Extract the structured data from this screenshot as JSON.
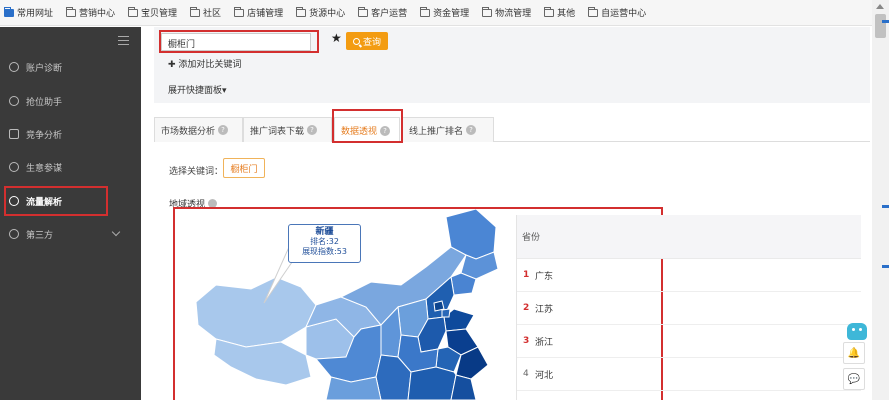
{
  "bookmarks": [
    {
      "label": "常用网址",
      "icon": "app-icon"
    },
    {
      "label": "营销中心",
      "icon": "folder-icon"
    },
    {
      "label": "宝贝管理",
      "icon": "folder-icon"
    },
    {
      "label": "社区",
      "icon": "folder-icon"
    },
    {
      "label": "店铺管理",
      "icon": "folder-icon"
    },
    {
      "label": "货源中心",
      "icon": "folder-icon"
    },
    {
      "label": "客户运营",
      "icon": "folder-icon"
    },
    {
      "label": "资金管理",
      "icon": "folder-icon"
    },
    {
      "label": "物流管理",
      "icon": "folder-icon"
    },
    {
      "label": "其他",
      "icon": "folder-icon"
    },
    {
      "label": "自运营中心",
      "icon": "folder-icon"
    }
  ],
  "sidebar": {
    "items": [
      {
        "label": "账户诊断",
        "icon": "diagnose-icon"
      },
      {
        "label": "抢位助手",
        "icon": "target-icon"
      },
      {
        "label": "竞争分析",
        "icon": "chart-icon"
      },
      {
        "label": "生意参谋",
        "icon": "compass-icon"
      },
      {
        "label": "流量解析",
        "icon": "flow-icon",
        "active": true
      },
      {
        "label": "第三方",
        "icon": "circle-icon",
        "has_submenu": true
      }
    ]
  },
  "search": {
    "keyword_value": "橱柜门",
    "query_label": "查询",
    "add_compare_label": "添加对比关键词",
    "expand_panel_label": "展开快捷面板"
  },
  "tabs": [
    {
      "label": "市场数据分析"
    },
    {
      "label": "推广词表下载"
    },
    {
      "label": "数据透视",
      "active": true
    },
    {
      "label": "线上推广排名"
    }
  ],
  "content": {
    "select_keyword_label": "选择关键词：",
    "selected_keyword": "橱柜门",
    "region_label": "地域透视"
  },
  "map_tooltip": {
    "region": "新疆",
    "rank_line": "排名:32",
    "index_line": "展现指数:53"
  },
  "ranking": {
    "header": "省份",
    "rows": [
      {
        "rank": "1",
        "province": "广东"
      },
      {
        "rank": "2",
        "province": "江苏"
      },
      {
        "rank": "3",
        "province": "浙江"
      },
      {
        "rank": "4",
        "province": "河北"
      }
    ]
  },
  "colors": {
    "accent_orange": "#f39c12",
    "highlight_red": "#d32f2f",
    "map_dark": "#08306b",
    "map_light": "#a8c8ec"
  }
}
